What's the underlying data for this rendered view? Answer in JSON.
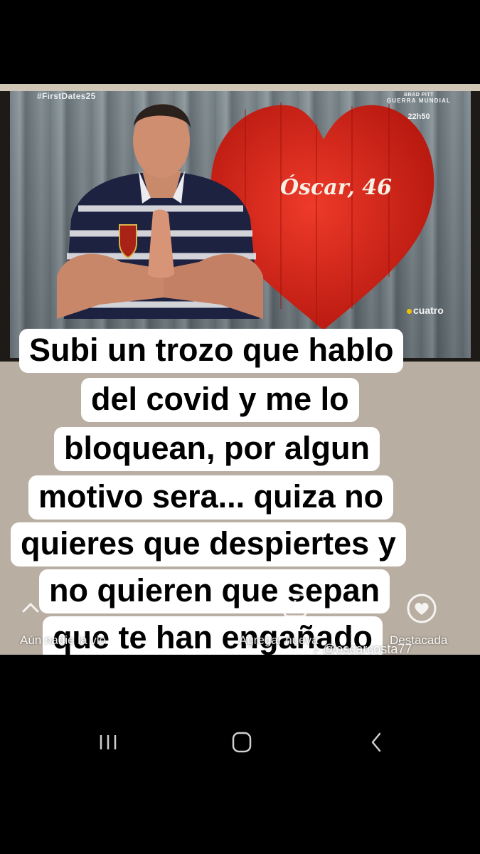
{
  "tv": {
    "hashtag": "#FirstDates25",
    "promo_line1": "BRAD PITT",
    "promo_line2": "GUERRA MUNDIAL",
    "promo_time": "22h50",
    "contestant_label": "Óscar, 46",
    "channel": "cuatro"
  },
  "caption": {
    "lines": [
      "Subi un trozo que hablo",
      "del covid y me lo",
      "bloquean, por algun",
      "motivo sera... quiza no",
      "quieres que despiertes y",
      "no quieren que sepan",
      "que te han engañado"
    ]
  },
  "story_controls": {
    "views_label": "Aún nadie la vio",
    "add_new_label": "Agregar nueva",
    "highlight_label": "Destacada",
    "tiktok_handle": "@oscarcosta77"
  },
  "navigation": {
    "recents_icon": "recent-apps-icon",
    "home_icon": "home-icon",
    "back_icon": "back-icon"
  },
  "colors": {
    "heart_red": "#d6261c",
    "caption_bg": "#ffffff",
    "caption_text": "#000000",
    "channel_dot": "#f2c200"
  }
}
